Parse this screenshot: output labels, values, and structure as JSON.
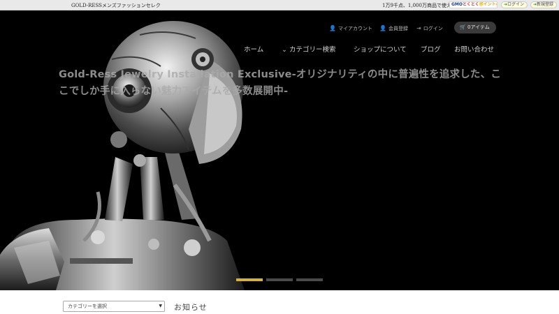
{
  "topbar": {
    "shop_name": "GOLD-RESSメンズファッションセレク",
    "promo": "1万9千点、1,000万商品で使える",
    "gmo_badge": {
      "a": "GMO",
      "b": "とくとく",
      "c": "ポイント",
      "icon": "plus-circle-icon"
    },
    "login_label": "ログイン",
    "register_label": "新規登録",
    "pill_icon": "green-arrow-icon"
  },
  "header": {
    "utility": {
      "account_label": "マイアカウント",
      "member_label": "会員登録",
      "login_label": "ログイン",
      "account_icon": "user-icon",
      "member_icon": "user-plus-icon",
      "login_icon": "sign-in-icon"
    },
    "cart": {
      "label": "0アイテム",
      "icon": "cart-icon"
    },
    "nav": {
      "home": "ホーム",
      "category": "カテゴリー検索",
      "category_icon": "chevron-down-icon",
      "about": "ショップについて",
      "blog": "ブログ",
      "contact": "お問い合わせ"
    }
  },
  "hero": {
    "tagline": "Gold-Ress Jewelry Installation Exclusive-オリジナリティの中に普遍性を追求した、ここでしか手に入らない魅力アイテムを多数展開中-",
    "slider": {
      "slide_count": 3,
      "active_index": 0,
      "active_color": "#d4b23b",
      "inactive_color": "#4a4a4a"
    }
  },
  "main": {
    "category_select": {
      "value": "カテゴリーを選択"
    },
    "news_title": "お知らせ"
  }
}
